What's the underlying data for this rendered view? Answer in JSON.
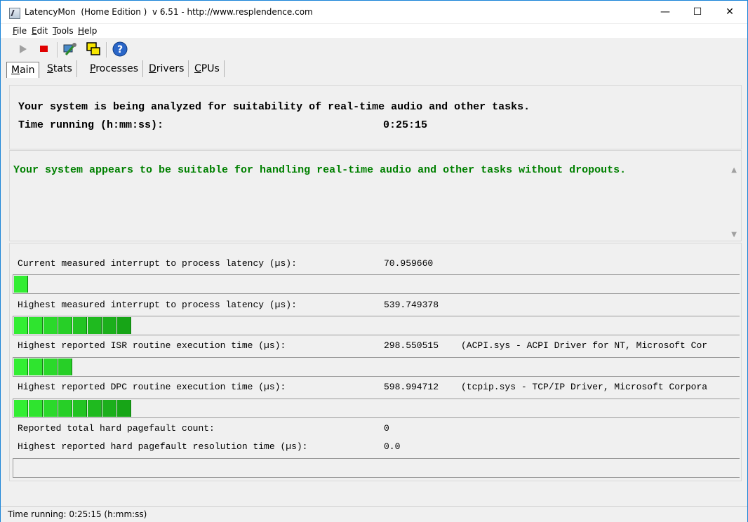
{
  "window": {
    "title": "LatencyMon  (Home Edition )  v 6.51 - http://www.resplendence.com",
    "minimize": "—",
    "maximize": "☐",
    "close": "✕"
  },
  "menu": [
    "File",
    "Edit",
    "Tools",
    "Help"
  ],
  "toolbar": {
    "play_icon": "play-icon",
    "stop_icon": "stop-icon",
    "settings_icon": "tools-icon",
    "windows_icon": "windows-icon",
    "help_icon": "help-icon"
  },
  "tabs": [
    "Main",
    "Stats",
    "Processes",
    "Drivers",
    "CPUs"
  ],
  "header": {
    "analyzing": "Your system is being analyzed for suitability of real-time audio and other tasks.",
    "time_label": "Time running (h:mm:ss):",
    "time_value": "0:25:15"
  },
  "verdict": {
    "text": "Your system appears to be suitable for handling real-time audio and other tasks without dropouts.",
    "color": "#008000"
  },
  "metrics": [
    {
      "label": "Current measured interrupt to process latency (µs):",
      "value": "70.959660",
      "detail": "",
      "segments": 1
    },
    {
      "label": "Highest measured interrupt to process latency (µs):",
      "value": "539.749378",
      "detail": "",
      "segments": 8
    },
    {
      "label": "Highest reported ISR routine execution time (µs):",
      "value": "298.550515",
      "detail": "(ACPI.sys - ACPI Driver for NT, Microsoft Cor",
      "segments": 4
    },
    {
      "label": "Highest reported DPC routine execution time (µs):",
      "value": "598.994712",
      "detail": "(tcpip.sys - TCP/IP Driver, Microsoft Corpora",
      "segments": 8
    }
  ],
  "pagefault": {
    "count_label": "Reported total hard pagefault count:",
    "count_value": "0",
    "time_label": "Highest reported hard pagefault resolution time (µs):",
    "time_value": "0.0",
    "segments": 0
  },
  "status": {
    "text": "Time running: 0:25:15  (h:mm:ss)"
  }
}
